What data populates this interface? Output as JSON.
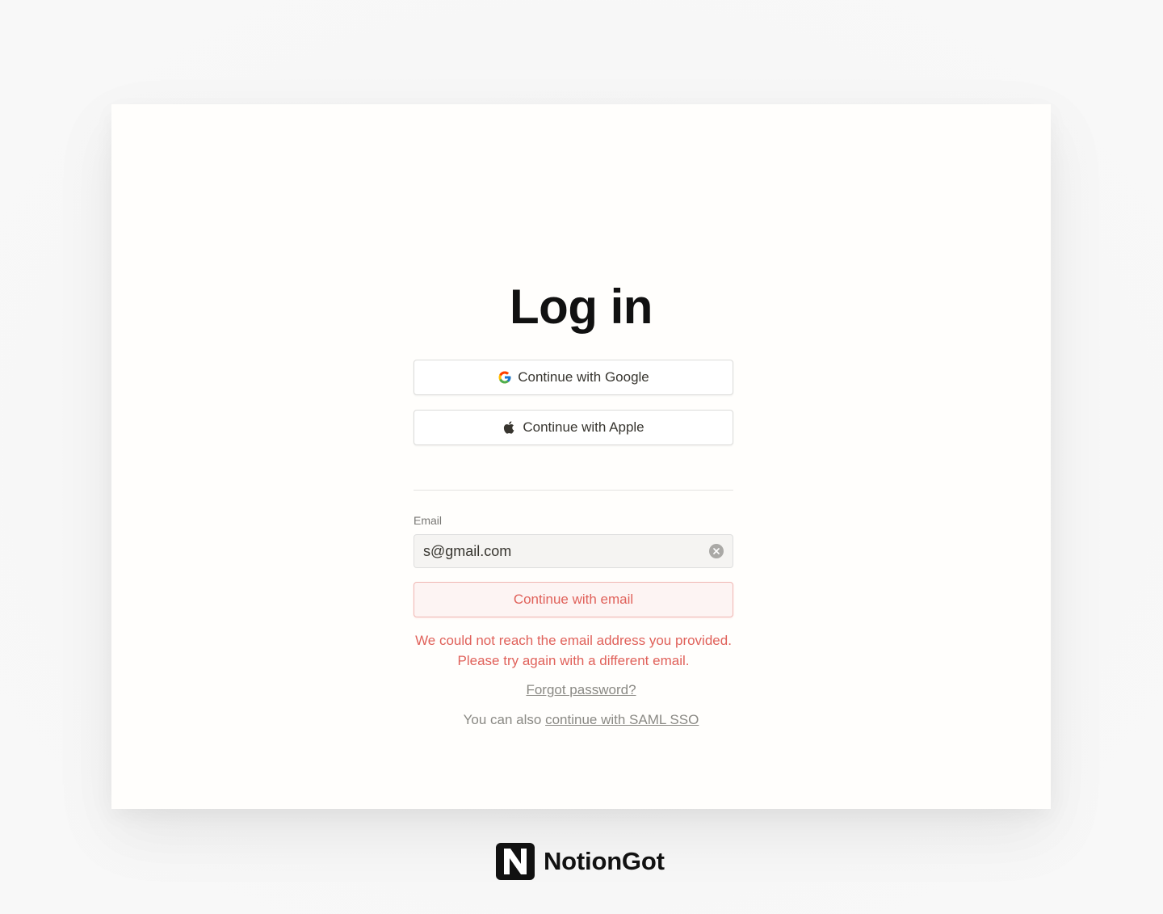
{
  "page": {
    "title": "Log in"
  },
  "auth": {
    "google_label": "Continue with Google",
    "apple_label": "Continue with Apple"
  },
  "email": {
    "label": "Email",
    "value": "s@gmail.com",
    "submit_label": "Continue with email",
    "error": "We could not reach the email address you provided. Please try again with a different email."
  },
  "links": {
    "forgot_password": "Forgot password?",
    "saml_prefix": "You can also ",
    "saml_link": "continue with SAML SSO"
  },
  "brand": {
    "name": "NotionGot",
    "logo_letter": "N"
  },
  "colors": {
    "error": "#e0615a",
    "card_bg": "#fffefc",
    "text": "#37352f"
  },
  "icons": {
    "google": "google-icon",
    "apple": "apple-icon",
    "clear": "clear-icon"
  }
}
